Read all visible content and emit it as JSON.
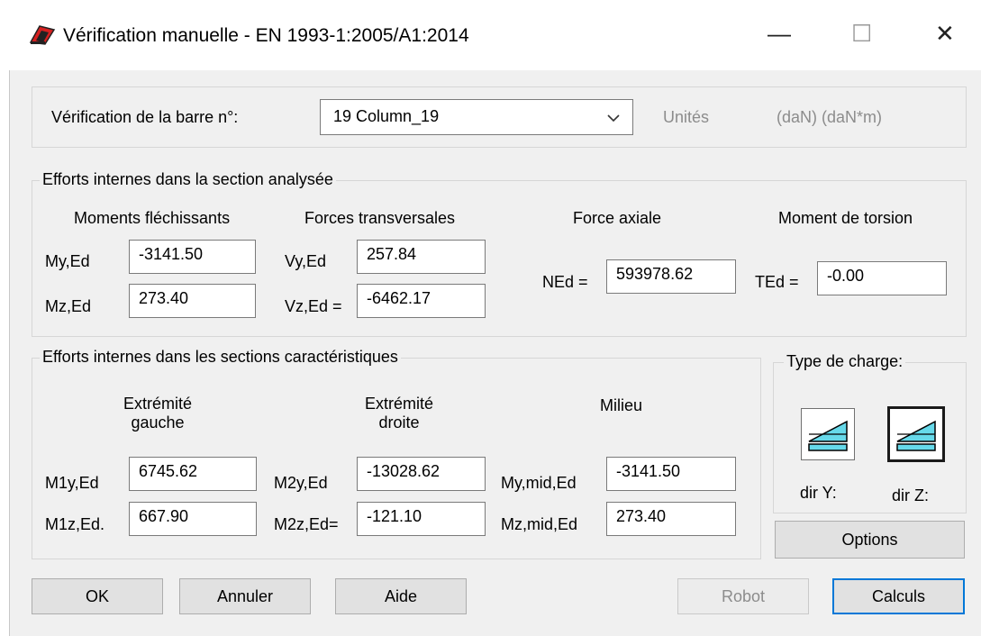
{
  "window": {
    "title": "Vérification manuelle - EN 1993-1:2005/A1:2014",
    "minimize": "—",
    "maximize": "☐",
    "close": "✕"
  },
  "bar": {
    "label": "Vérification de la barre n°:",
    "selected": "19  Column_19",
    "units_label": "Unités",
    "units_value": "(daN) (daN*m)"
  },
  "internal": {
    "legend": "Efforts internes dans la section analysée",
    "col_moments": "Moments fléchissants",
    "col_shear": "Forces transversales",
    "col_axial": "Force axiale",
    "col_torsion": "Moment de torsion",
    "my_label": "My,Ed",
    "my_value": "-3141.50",
    "mz_label": "Mz,Ed",
    "mz_value": "273.40",
    "vy_label": "Vy,Ed",
    "vy_value": "257.84",
    "vz_label": "Vz,Ed =",
    "vz_value": "-6462.17",
    "ned_label": "NEd =",
    "ned_value": "593978.62",
    "ted_label": "TEd =",
    "ted_value": "-0.00"
  },
  "characteristic": {
    "legend": "Efforts internes dans les sections caractéristiques",
    "left_line1": "Extrémité",
    "left_line2": "gauche",
    "right_line1": "Extrémité",
    "right_line2": "droite",
    "middle": "Milieu",
    "m1y_label": "M1y,Ed",
    "m1y_value": "6745.62",
    "m1z_label": "M1z,Ed.",
    "m1z_value": "667.90",
    "m2y_label": "M2y,Ed",
    "m2y_value": "-13028.62",
    "m2z_label": "M2z,Ed=",
    "m2z_value": "-121.10",
    "mymid_label": "My,mid,Ed",
    "mymid_value": "-3141.50",
    "mzmid_label": "Mz,mid,Ed",
    "mzmid_value": "273.40"
  },
  "load_type": {
    "legend": "Type de charge:",
    "dir_y": "dir Y:",
    "dir_z": "dir Z:",
    "options": "Options"
  },
  "buttons": {
    "ok": "OK",
    "cancel": "Annuler",
    "help": "Aide",
    "robot": "Robot",
    "calc": "Calculs"
  },
  "colors": {
    "accent": "#0078d7",
    "icon_fill": "#66d9ea",
    "app_icon_red": "#d62020"
  }
}
